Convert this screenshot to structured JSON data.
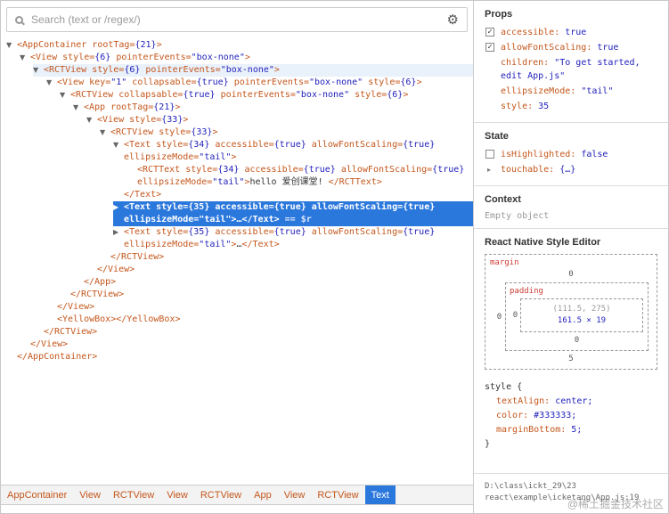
{
  "watermark": "@稀土掘金技术社区",
  "search": {
    "placeholder": "Search (text or /regex/)"
  },
  "icons": {
    "gear": "⚙"
  },
  "tree": {
    "rows": [
      {
        "indent": 0,
        "arrow": "▼",
        "segs": [
          [
            "t",
            "<AppContainer"
          ],
          [
            "a",
            " rootTag="
          ],
          [
            "v",
            "{21}"
          ],
          [
            "t",
            ">"
          ]
        ]
      },
      {
        "indent": 1,
        "arrow": "▼",
        "segs": [
          [
            "t",
            "<View"
          ],
          [
            "a",
            " style="
          ],
          [
            "v",
            "{6}"
          ],
          [
            "a",
            " pointerEvents="
          ],
          [
            "v",
            "\"box-none\""
          ],
          [
            "t",
            ">"
          ]
        ]
      },
      {
        "indent": 2,
        "arrow": "▼",
        "state": "hovered",
        "segs": [
          [
            "t",
            "<RCTView"
          ],
          [
            "a",
            " style="
          ],
          [
            "v",
            "{6}"
          ],
          [
            "a",
            " pointerEvents="
          ],
          [
            "v",
            "\"box-none\""
          ],
          [
            "t",
            ">"
          ]
        ]
      },
      {
        "indent": 3,
        "arrow": "▼",
        "segs": [
          [
            "t",
            "<View"
          ],
          [
            "a",
            " key="
          ],
          [
            "v",
            "\"1\""
          ],
          [
            "a",
            " collapsable="
          ],
          [
            "v",
            "{true}"
          ],
          [
            "a",
            " pointerEvents="
          ],
          [
            "v",
            "\"box-none\""
          ],
          [
            "a",
            " style="
          ],
          [
            "v",
            "{6}"
          ],
          [
            "t",
            ">"
          ]
        ]
      },
      {
        "indent": 4,
        "arrow": "▼",
        "segs": [
          [
            "t",
            "<RCTView"
          ],
          [
            "a",
            " collapsable="
          ],
          [
            "v",
            "{true}"
          ],
          [
            "a",
            " pointerEvents="
          ],
          [
            "v",
            "\"box-none\""
          ],
          [
            "a",
            " style="
          ],
          [
            "v",
            "{6}"
          ],
          [
            "t",
            ">"
          ]
        ]
      },
      {
        "indent": 5,
        "arrow": "▼",
        "segs": [
          [
            "t",
            "<App"
          ],
          [
            "a",
            " rootTag="
          ],
          [
            "v",
            "{21}"
          ],
          [
            "t",
            ">"
          ]
        ]
      },
      {
        "indent": 6,
        "arrow": "▼",
        "segs": [
          [
            "t",
            "<View"
          ],
          [
            "a",
            " style="
          ],
          [
            "v",
            "{33}"
          ],
          [
            "t",
            ">"
          ]
        ]
      },
      {
        "indent": 7,
        "arrow": "▼",
        "segs": [
          [
            "t",
            "<RCTView"
          ],
          [
            "a",
            " style="
          ],
          [
            "v",
            "{33}"
          ],
          [
            "t",
            ">"
          ]
        ]
      },
      {
        "indent": 8,
        "arrow": "▼",
        "segs": [
          [
            "t",
            "<Text"
          ],
          [
            "a",
            " style="
          ],
          [
            "v",
            "{34}"
          ],
          [
            "a",
            " accessible="
          ],
          [
            "v",
            "{true}"
          ],
          [
            "a",
            " allowFontScaling="
          ],
          [
            "v",
            "{true}"
          ],
          [
            "a",
            " ellipsizeMode="
          ],
          [
            "v",
            "\"tail\""
          ],
          [
            "t",
            ">"
          ]
        ]
      },
      {
        "indent": 9,
        "arrow": "",
        "segs": [
          [
            "t",
            "<RCTText"
          ],
          [
            "a",
            " style="
          ],
          [
            "v",
            "{34}"
          ],
          [
            "a",
            " accessible="
          ],
          [
            "v",
            "{true}"
          ],
          [
            "a",
            " allowFontScaling="
          ],
          [
            "v",
            "{true}"
          ],
          [
            "a",
            " ellipsizeMode="
          ],
          [
            "v",
            "\"tail\""
          ],
          [
            "t",
            ">"
          ],
          [
            "x",
            "hello 爱创课堂! "
          ],
          [
            "t",
            "</RCTText>"
          ]
        ]
      },
      {
        "indent": 8,
        "arrow": "",
        "segs": [
          [
            "t",
            "</Text>"
          ]
        ]
      },
      {
        "indent": 8,
        "arrow": "▶",
        "state": "selected",
        "segs": [
          [
            "t",
            "<Text"
          ],
          [
            "a",
            " style="
          ],
          [
            "v",
            "{35}"
          ],
          [
            "a",
            " accessible="
          ],
          [
            "v",
            "{true}"
          ],
          [
            "a",
            " allowFontScaling="
          ],
          [
            "v",
            "{true}"
          ],
          [
            "a",
            " ellipsizeMode="
          ],
          [
            "v",
            "\"tail\""
          ],
          [
            "t",
            ">"
          ],
          [
            "x",
            "…"
          ],
          [
            "t",
            "</Text>"
          ],
          [
            "d",
            " == $r"
          ]
        ]
      },
      {
        "indent": 8,
        "arrow": "▶",
        "segs": [
          [
            "t",
            "<Text"
          ],
          [
            "a",
            " style="
          ],
          [
            "v",
            "{35}"
          ],
          [
            "a",
            " accessible="
          ],
          [
            "v",
            "{true}"
          ],
          [
            "a",
            " allowFontScaling="
          ],
          [
            "v",
            "{true}"
          ],
          [
            "a",
            " ellipsizeMode="
          ],
          [
            "v",
            "\"tail\""
          ],
          [
            "t",
            ">"
          ],
          [
            "x",
            "…"
          ],
          [
            "t",
            "</Text>"
          ]
        ]
      },
      {
        "indent": 7,
        "arrow": "",
        "segs": [
          [
            "t",
            "</RCTView>"
          ]
        ]
      },
      {
        "indent": 6,
        "arrow": "",
        "segs": [
          [
            "t",
            "</View>"
          ]
        ]
      },
      {
        "indent": 5,
        "arrow": "",
        "segs": [
          [
            "t",
            "</App>"
          ]
        ]
      },
      {
        "indent": 4,
        "arrow": "",
        "segs": [
          [
            "t",
            "</RCTView>"
          ]
        ]
      },
      {
        "indent": 3,
        "arrow": "",
        "segs": [
          [
            "t",
            "</View>"
          ]
        ]
      },
      {
        "indent": 3,
        "arrow": "",
        "segs": [
          [
            "t",
            "<YellowBox>"
          ],
          [
            "t",
            "</YellowBox>"
          ]
        ]
      },
      {
        "indent": 2,
        "arrow": "",
        "segs": [
          [
            "t",
            "</RCTView>"
          ]
        ]
      },
      {
        "indent": 1,
        "arrow": "",
        "segs": [
          [
            "t",
            "</View>"
          ]
        ]
      },
      {
        "indent": 0,
        "arrow": "",
        "segs": [
          [
            "t",
            "</AppContainer>"
          ]
        ]
      }
    ]
  },
  "props_panel": {
    "title": "Props",
    "items": [
      {
        "checkbox": "checked",
        "key": "accessible",
        "value": "true"
      },
      {
        "checkbox": "checked",
        "key": "allowFontScaling",
        "value": "true"
      },
      {
        "key": "children",
        "value": "\"To get started, edit App.js\""
      },
      {
        "key": "ellipsizeMode",
        "value": "\"tail\""
      },
      {
        "key": "style",
        "value": "35"
      }
    ]
  },
  "state_panel": {
    "title": "State",
    "items": [
      {
        "checkbox": "unchecked",
        "key": "isHighlighted",
        "value": "false"
      },
      {
        "arrow": "▸",
        "key": "touchable",
        "value": "{…}"
      }
    ]
  },
  "context_panel": {
    "title": "Context",
    "empty_text": "Empty object"
  },
  "style_editor": {
    "title": "React Native Style Editor",
    "box_model": {
      "margin_label": "margin",
      "margin_top": "0",
      "margin_left": "0",
      "margin_bottom": "5",
      "padding_label": "padding",
      "padding_left": "0",
      "padding_bottom": "0",
      "position": "(111.5, 275)",
      "size": "161.5 × 19"
    },
    "style_block": {
      "open": "style {",
      "rules": [
        {
          "key": "textAlign",
          "value": "center"
        },
        {
          "key": "color",
          "value": "#333333"
        },
        {
          "key": "marginBottom",
          "value": "5"
        }
      ],
      "close": "}"
    },
    "source_line1": "D:\\class\\ickt_29\\23",
    "source_line2": "react\\example\\icketang\\App.js:19"
  },
  "breadcrumbs": {
    "items": [
      {
        "label": "AppContainer",
        "selected": false
      },
      {
        "label": "View",
        "selected": false
      },
      {
        "label": "RCTView",
        "selected": false
      },
      {
        "label": "View",
        "selected": false
      },
      {
        "label": "RCTView",
        "selected": false
      },
      {
        "label": "App",
        "selected": false
      },
      {
        "label": "View",
        "selected": false
      },
      {
        "label": "RCTView",
        "selected": false
      },
      {
        "label": "Text",
        "selected": true
      }
    ]
  }
}
